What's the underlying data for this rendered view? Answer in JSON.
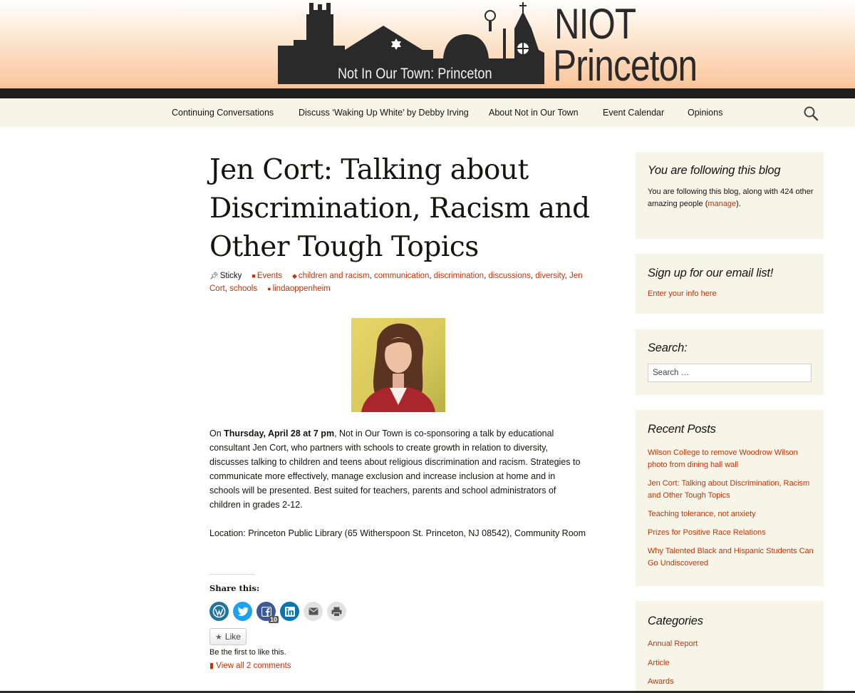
{
  "header": {
    "brand_line1": "NIOT",
    "brand_line2": "Princeton",
    "tagline": "Not In Our Town: Princeton"
  },
  "nav": {
    "items": [
      {
        "label": "Continuing Conversations"
      },
      {
        "label": "Discuss ‘Waking Up White’ by Debby Irving"
      },
      {
        "label": "About Not in Our Town"
      },
      {
        "label": "Event Calendar"
      },
      {
        "label": "Opinions"
      }
    ],
    "search_icon": "search-icon"
  },
  "post": {
    "title": "Jen Cort: Talking about Discrimination, Racism and Other Tough  Topics",
    "meta": {
      "sticky": "Sticky",
      "category": "Events",
      "tags": [
        "children and racism",
        "communication",
        "discrimination",
        "discussions",
        "diversity",
        "Jen Cort",
        "schools"
      ],
      "author": "lindaoppenheim"
    },
    "paragraph1": {
      "pre": "On ",
      "bold": "Thursday, April 28 at 7 pm",
      "post": ", Not in Our Town is co-sponsoring a talk by educational consultant Jen Cort, who partners with schools to create growth in relation to diversity, discusses talking to children and teens about religious discrimination and racism. Strategies to communicate more effectively, manage exclusion and increase inclusion at home and in schools will be presented. Best suited for teachers, parents and school administrators of children in grades 2-12."
    },
    "paragraph2": "Location: Princeton Public Library (65 Witherspoon St. Princeton, NJ 08542), Community Room",
    "share": {
      "label": "Share this:",
      "facebook_count": "10"
    },
    "like": {
      "button": "Like",
      "text": "Be the first to like this."
    },
    "comments_link": "View all 2 comments"
  },
  "sidebar": {
    "following": {
      "title": "You are following this blog",
      "text_pre": "You are following this blog, along with 424 other amazing people (",
      "manage_link": "manage",
      "text_post": ")."
    },
    "signup": {
      "title": "Sign up for our email list!",
      "link": "Enter your info here"
    },
    "search": {
      "title": "Search:",
      "placeholder": "Search …"
    },
    "recent_posts": {
      "title": "Recent Posts",
      "items": [
        "Wilson College to remove Woodrow Wilson photo from dining hall wall",
        "Jen Cort: Talking about Discrimination, Racism and Other Tough Topics",
        "Teaching tolerance, not anxiety",
        "Prizes for Positive Race Relations",
        "Why Talented Black and Hispanic Students Can Go Undiscovered"
      ]
    },
    "categories": {
      "title": "Categories",
      "items": [
        "Annual Report",
        "Article",
        "Awards"
      ]
    }
  },
  "colors": {
    "link": "#bc360a",
    "nav_bg": "#f7f5e7",
    "dark_bar": "#1e1e1e"
  }
}
